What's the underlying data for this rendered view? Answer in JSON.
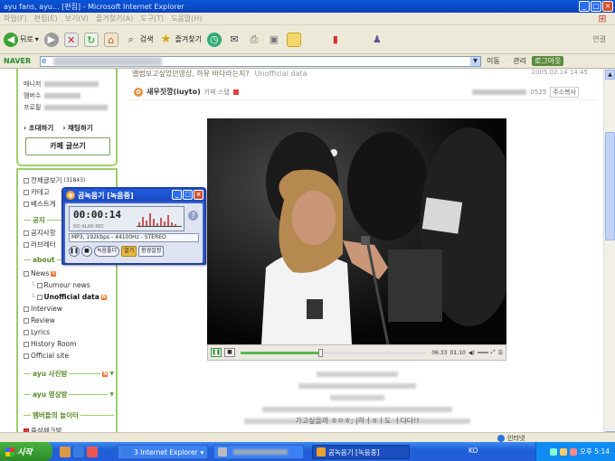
{
  "window": {
    "title": "ayu fans, ayu... [편집] - Microsoft Internet Explorer",
    "min": "_",
    "max": "□",
    "close": "×"
  },
  "menu": [
    "파일(F)",
    "편집(E)",
    "보기(V)",
    "즐겨찾기(A)",
    "도구(T)",
    "도움말(H)"
  ],
  "toolbar": {
    "back_label": "뒤로",
    "search_label": "검색",
    "favorites_label": "즐겨찾기",
    "links_label": "연결"
  },
  "address": {
    "naver_label": "NAVER",
    "go_label": "이동",
    "manage_label": "관리",
    "login_label": "로그아웃"
  },
  "sidebar": {
    "profile": {
      "manager_label": "매니저",
      "members_label": "멤버수",
      "profile_label": "프로필"
    },
    "invite_label": "초대하기",
    "chat_label": "채팅하기",
    "write_button": "카페 글쓰기",
    "top_items": [
      {
        "label": "전체글보기",
        "count": "(31843)"
      },
      {
        "label": "카테고",
        "count": ""
      },
      {
        "label": "베스트게",
        "count": ""
      }
    ],
    "notice_section": "공지",
    "notice_items": [
      {
        "label": "공지사항"
      },
      {
        "label": "러브레터"
      }
    ],
    "about_section": "about",
    "about_items": [
      {
        "label": "News",
        "indent": false,
        "bold": false,
        "new": true
      },
      {
        "label": "Rumour news",
        "indent": true,
        "bold": false,
        "new": false
      },
      {
        "label": "Unofficial data",
        "indent": true,
        "bold": true,
        "new": true
      },
      {
        "label": "Interview",
        "indent": false,
        "bold": false,
        "new": false
      },
      {
        "label": "Review",
        "indent": false,
        "bold": false,
        "new": false
      },
      {
        "label": "Lyrics",
        "indent": false,
        "bold": false,
        "new": false
      },
      {
        "label": "History Room",
        "indent": false,
        "bold": false,
        "new": false
      },
      {
        "label": "Official site",
        "indent": false,
        "bold": false,
        "new": false
      }
    ],
    "photo_section": "ayu 사진방",
    "video_section": "ayu 영상방",
    "play_section": "멤버들의 놀이터",
    "attendance": "출석체크방"
  },
  "post": {
    "title": "앨범보고싶었던영상, 하유 바다라는지?",
    "category": "Unofficial data",
    "date": "2005.02.14 14:45",
    "author": "새우짓깡(iuyto)",
    "cafe_label": "카페 스탭",
    "views_text": "0525",
    "address_tag": "주소복사",
    "lyric_line": "가고싶을까 ㅎㅇㅎ; |하ㅓㅎㅣ도 ㅓ다다!!"
  },
  "player": {
    "current_time": "06:33",
    "total_time": "01:10",
    "progress": 0.42
  },
  "recorder": {
    "title": "곰녹음기 [녹음중]",
    "time": "00:00:14",
    "status_mini": "NO ALAN  REC",
    "format": "MP3, 192kbps - 44100Hz - STEREO",
    "open_dir": "녹음폴더",
    "open_btn": "열기",
    "settings_btn": "환경설정",
    "help": "?"
  },
  "status_bar": {
    "zone": "인터넷"
  },
  "taskbar": {
    "start": "시작",
    "ie_task": "3 Internet Explorer",
    "rec_task": "곰녹음기 [녹음중]",
    "lang": "KO",
    "clock": "오후 5:14"
  }
}
